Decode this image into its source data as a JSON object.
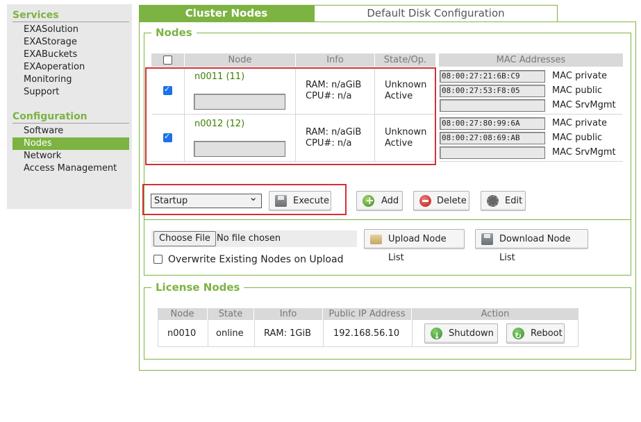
{
  "sidebar": {
    "services_heading": "Services",
    "services": [
      "EXASolution",
      "EXAStorage",
      "EXABuckets",
      "EXAoperation",
      "Monitoring",
      "Support"
    ],
    "config_heading": "Configuration",
    "config": [
      "Software",
      "Nodes",
      "Network",
      "Access Management"
    ],
    "active": "Nodes"
  },
  "tabs": {
    "active": "Cluster Nodes",
    "inactive": "Default Disk Configuration"
  },
  "nodes_section": {
    "legend": "Nodes",
    "headers": {
      "node": "Node",
      "info": "Info",
      "state": "State/Op.",
      "mac": "MAC Addresses"
    },
    "rows": [
      {
        "name": "n0011 (11)",
        "checked": true,
        "ram": "RAM: n/aGiB",
        "cpu": "CPU#: n/a",
        "state": "Unknown",
        "op": "Active",
        "mac_private": "08:00:27:21:6B:C9",
        "mac_public": "08:00:27:53:F8:05",
        "mac_srv": "",
        "label_private": "MAC private",
        "label_public": "MAC public",
        "label_srv": "MAC SrvMgmt"
      },
      {
        "name": "n0012 (12)",
        "checked": true,
        "ram": "RAM: n/aGiB",
        "cpu": "CPU#: n/a",
        "state": "Unknown",
        "op": "Active",
        "mac_private": "08:00:27:80:99:6A",
        "mac_public": "08:00:27:08:69:AB",
        "mac_srv": "",
        "label_private": "MAC private",
        "label_public": "MAC public",
        "label_srv": "MAC SrvMgmt"
      }
    ],
    "action_select": "Startup",
    "buttons": {
      "execute": "Execute",
      "add": "Add",
      "delete": "Delete",
      "edit": "Edit"
    },
    "file": {
      "choose": "Choose File",
      "status": "No file chosen"
    },
    "upload": "Upload Node List",
    "download": "Download Node List",
    "overwrite": "Overwrite Existing Nodes on Upload"
  },
  "license_section": {
    "legend": "License Nodes",
    "headers": {
      "node": "Node",
      "state": "State",
      "info": "Info",
      "ip": "Public IP Address",
      "action": "Action"
    },
    "row": {
      "node": "n0010",
      "state": "online",
      "info": "RAM: 1GiB",
      "ip": "192.168.56.10"
    },
    "buttons": {
      "shutdown": "Shutdown",
      "reboot": "Reboot"
    }
  },
  "colors": {
    "accent": "#7cb342",
    "highlight": "#d32f3a"
  }
}
